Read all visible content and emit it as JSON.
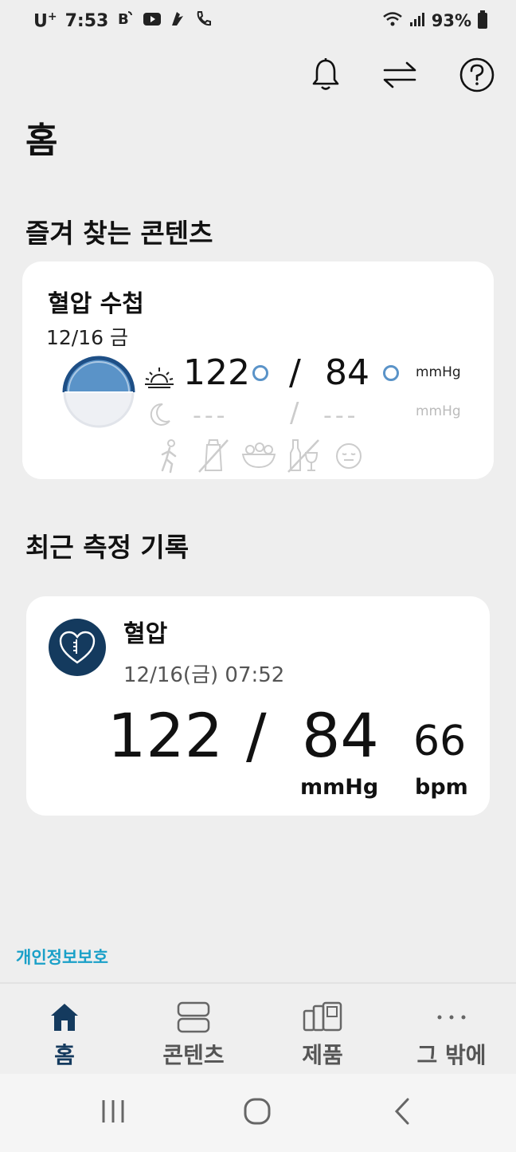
{
  "status_bar": {
    "carrier": "U",
    "carrier_sup": "+",
    "time": "7:53",
    "battery": "93%"
  },
  "header": {
    "icons": [
      "bell-icon",
      "sync-icon",
      "help-icon"
    ],
    "title": "홈"
  },
  "favorites": {
    "section_title": "즐겨 찾는 콘텐츠",
    "card": {
      "title": "혈압 수첩",
      "date": "12/16 금",
      "morning": {
        "systolic": "122",
        "separator": "/",
        "diastolic": "84",
        "unit": "mmHg"
      },
      "evening": {
        "systolic": "---",
        "separator": "/",
        "diastolic": "---",
        "unit": "mmHg"
      },
      "activity_icons": [
        "exercise-icon",
        "no-salt-icon",
        "food-icon",
        "no-alcohol-icon",
        "mood-icon"
      ]
    }
  },
  "recent": {
    "section_title": "최근 측정 기록",
    "card": {
      "name": "혈압",
      "datetime": "12/16(금) 07:52",
      "systolic": "122",
      "separator": "/",
      "diastolic": "84",
      "bp_unit": "mmHg",
      "pulse": "66",
      "pulse_unit": "bpm"
    }
  },
  "privacy_link": "개인정보보호",
  "bottom_nav": {
    "items": [
      {
        "label": "홈",
        "icon": "home-icon",
        "active": true
      },
      {
        "label": "콘텐츠",
        "icon": "contents-icon",
        "active": false
      },
      {
        "label": "제품",
        "icon": "products-icon",
        "active": false
      },
      {
        "label": "그 밖에",
        "icon": "more-icon",
        "active": false
      }
    ]
  },
  "colors": {
    "accent": "#143a5e",
    "link": "#1aa0c8",
    "gauge": "#5a93c8",
    "background": "#eeeeee"
  }
}
